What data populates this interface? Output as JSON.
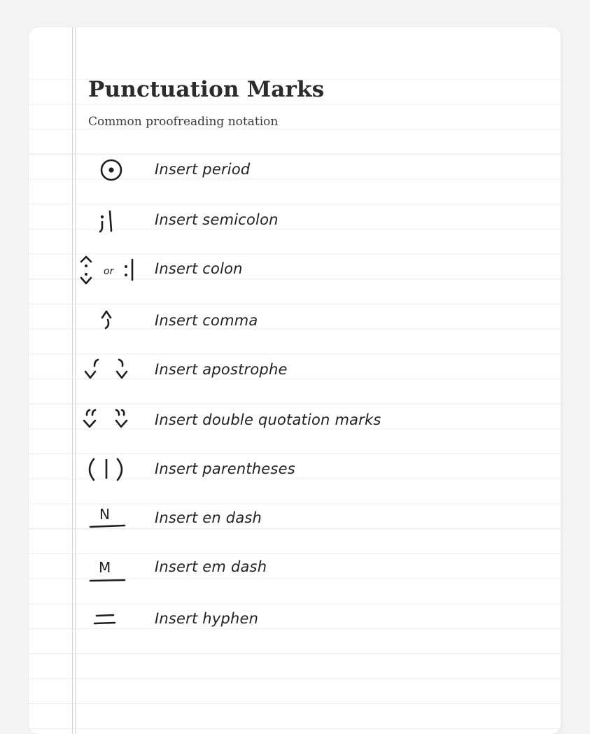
{
  "page": {
    "title": "Punctuation Marks",
    "subtitle": "Common proofreading notation"
  },
  "marks": [
    {
      "icon": "circled-period-icon",
      "label": "Insert period"
    },
    {
      "icon": "semicolon-caret-icon",
      "label": "Insert semicolon"
    },
    {
      "icon": "colon-caret-icon",
      "label": "Insert colon",
      "symbol_connector": "or"
    },
    {
      "icon": "comma-caret-icon",
      "label": "Insert comma"
    },
    {
      "icon": "apostrophe-caret-icon",
      "label": "Insert apostrophe"
    },
    {
      "icon": "double-quote-caret-icon",
      "label": "Insert double quotation marks"
    },
    {
      "icon": "parentheses-icon",
      "label": "Insert parentheses"
    },
    {
      "icon": "en-dash-icon",
      "label": "Insert en dash",
      "symbol_letter": "N"
    },
    {
      "icon": "em-dash-icon",
      "label": "Insert em dash",
      "symbol_letter": "M"
    },
    {
      "icon": "hyphen-icon",
      "label": "Insert hyphen"
    }
  ],
  "colors": {
    "background": "#f3f3f3",
    "paper": "#ffffff",
    "rule_line": "#ececec",
    "margin_line": "#f5c6d2",
    "ink": "#1e1e1e"
  }
}
